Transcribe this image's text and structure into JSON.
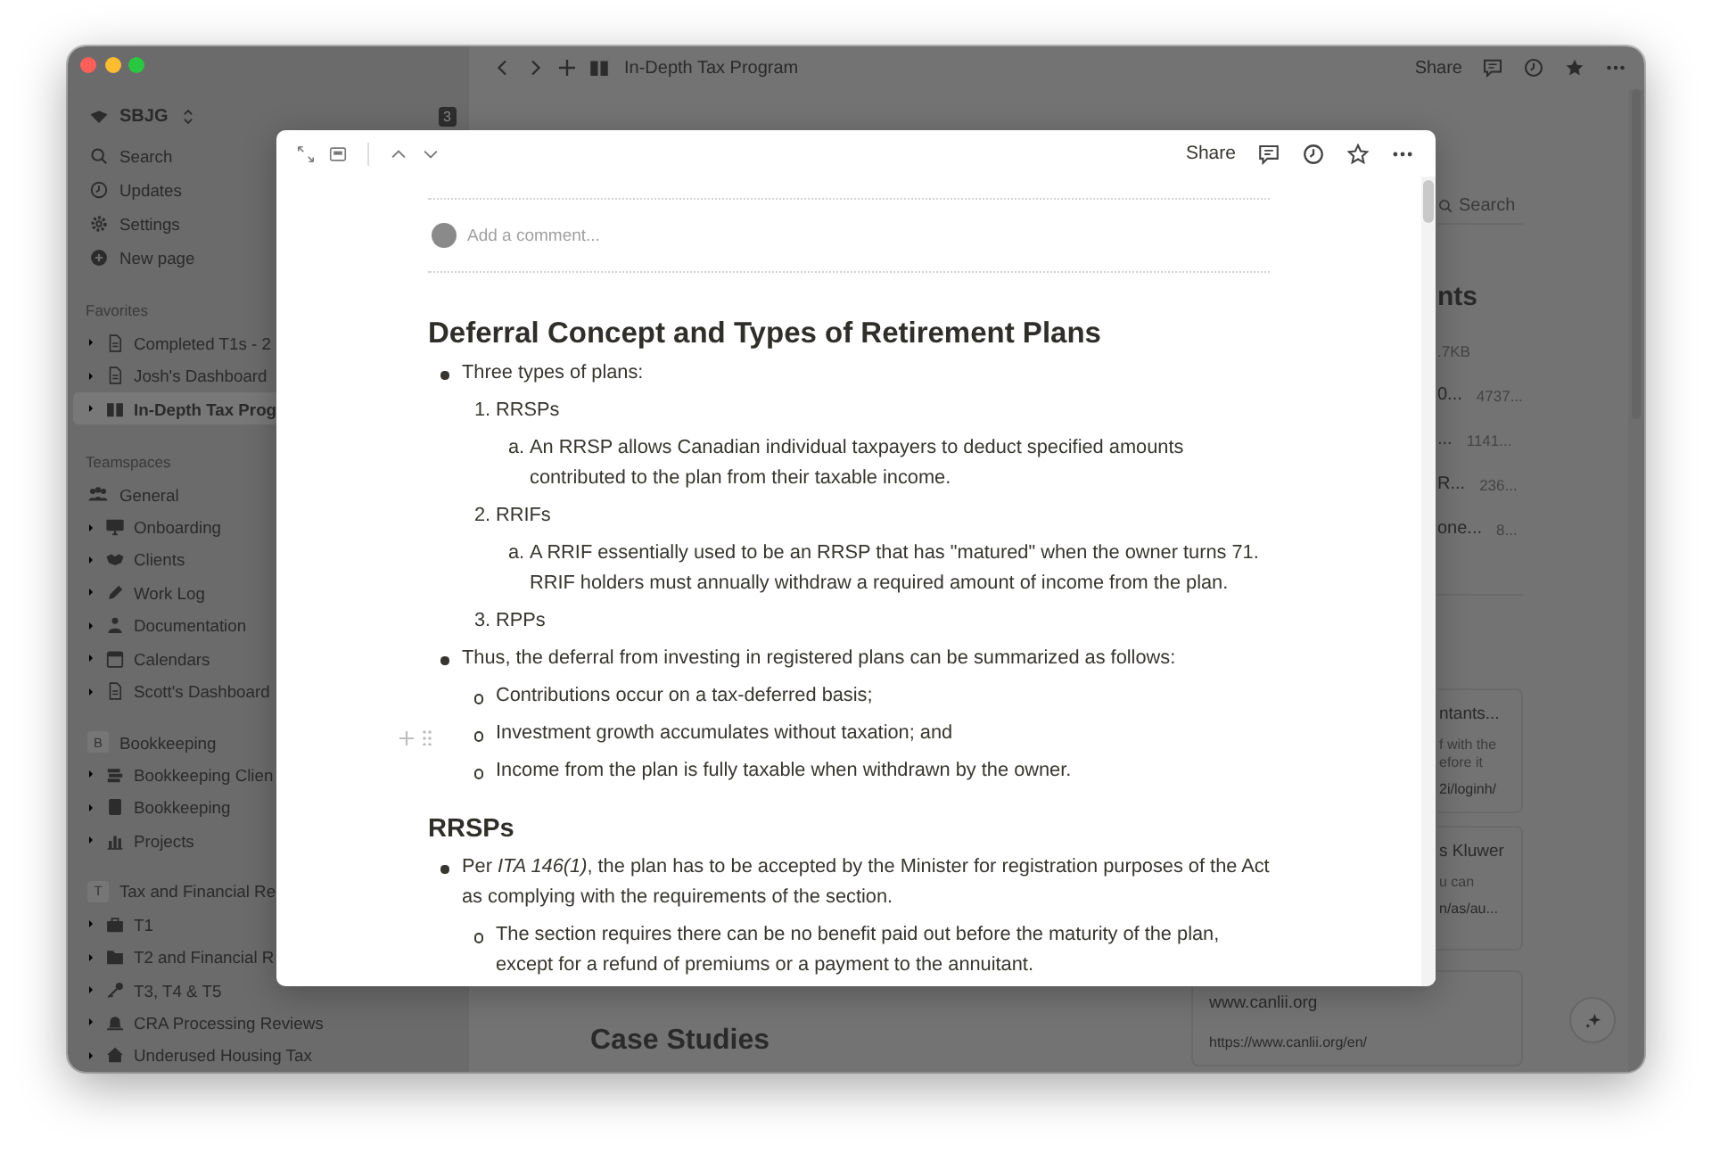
{
  "sidebar": {
    "workspace": {
      "name": "SBJG",
      "badge": "3"
    },
    "nav": [
      {
        "label": "Search"
      },
      {
        "label": "Updates"
      },
      {
        "label": "Settings"
      },
      {
        "label": "New page"
      }
    ],
    "favorites": {
      "label": "Favorites",
      "items": [
        {
          "label": "Completed T1s - 2",
          "selected": false
        },
        {
          "label": "Josh's Dashboard",
          "selected": false
        },
        {
          "label": "In-Depth Tax Prog",
          "selected": true
        }
      ]
    },
    "teamspaces": {
      "label": "Teamspaces",
      "spaces": [
        {
          "name": "General",
          "items": [
            {
              "label": "Onboarding"
            },
            {
              "label": "Clients"
            },
            {
              "label": "Work Log"
            },
            {
              "label": "Documentation"
            },
            {
              "label": "Calendars"
            },
            {
              "label": "Scott's Dashboard"
            }
          ]
        },
        {
          "name": "Bookkeeping",
          "initial": "B",
          "items": [
            {
              "label": "Bookkeeping Clien"
            },
            {
              "label": "Bookkeeping"
            },
            {
              "label": "Projects"
            }
          ]
        },
        {
          "name": "Tax and Financial Re",
          "initial": "T",
          "items": [
            {
              "label": "T1"
            },
            {
              "label": "T2 and Financial R"
            },
            {
              "label": "T3, T4 & T5"
            },
            {
              "label": "CRA Processing Reviews"
            },
            {
              "label": "Underused Housing Tax"
            }
          ]
        }
      ]
    }
  },
  "topbar": {
    "breadcrumb": "In-Depth Tax Program",
    "share": "Share"
  },
  "right_panel": {
    "search": "Search",
    "heading": "nts",
    "files": [
      {
        "size": ".7KB"
      },
      {
        "name": "0...",
        "size": "4737..."
      },
      {
        "name": "...",
        "size": "1141..."
      },
      {
        "name": "R...",
        "size": "236..."
      },
      {
        "name": "one...",
        "size": "8..."
      }
    ],
    "cards": [
      {
        "title": "ntants...",
        "lines": [
          "f with the",
          "efore it"
        ],
        "url": "2i/loginh/"
      },
      {
        "title": "s Kluwer",
        "lines": [
          "u can"
        ],
        "url": "n/as/au..."
      },
      {
        "title": "www.canlii.org",
        "url": "https://www.canlii.org/en/"
      }
    ]
  },
  "page_heading": "Case Studies",
  "modal": {
    "share": "Share",
    "comment_placeholder": "Add a comment...",
    "blocks": [
      {
        "kind": "h2",
        "text": "Deferral Concept and Types of Retirement Plans"
      },
      {
        "kind": "bullet",
        "text": "Three types of plans:",
        "children": [
          {
            "kind": "numbered",
            "marker": "1.",
            "text": "RRSPs",
            "children": [
              {
                "kind": "numbered",
                "marker": "a.",
                "text": "An RRSP allows Canadian individual taxpayers to deduct specified amounts contributed to the plan from their taxable income."
              }
            ]
          },
          {
            "kind": "numbered",
            "marker": "2.",
            "text": "RRIFs",
            "children": [
              {
                "kind": "numbered",
                "marker": "a.",
                "text": "A RRIF essentially used to be an RRSP that has \"matured\" when the owner turns 71. RRIF holders must annually withdraw a required amount of income from the plan."
              }
            ]
          },
          {
            "kind": "numbered",
            "marker": "3.",
            "text": "RPPs"
          }
        ]
      },
      {
        "kind": "bullet",
        "text": "Thus, the deferral from investing in registered plans can be summarized as follows:",
        "children": [
          {
            "kind": "bullet",
            "text": "Contributions occur on a tax-deferred basis;",
            "hovered": false
          },
          {
            "kind": "bullet",
            "text": "Investment growth accumulates without taxation; and",
            "hovered": true
          },
          {
            "kind": "bullet",
            "text": "Income from the plan is fully taxable when withdrawn by the owner.",
            "hovered": false
          }
        ]
      },
      {
        "kind": "h3",
        "text": "RRSPs"
      },
      {
        "kind": "bullet",
        "text": "Per *ITA 146(1)*, the plan has to be accepted by the Minister for registration purposes of the Act as complying with the requirements of the section.",
        "children": [
          {
            "kind": "bullet",
            "text": "The section requires there can be no benefit paid out before the maturity of the plan, except for a refund of premiums or a payment to the annuitant."
          }
        ]
      }
    ]
  }
}
